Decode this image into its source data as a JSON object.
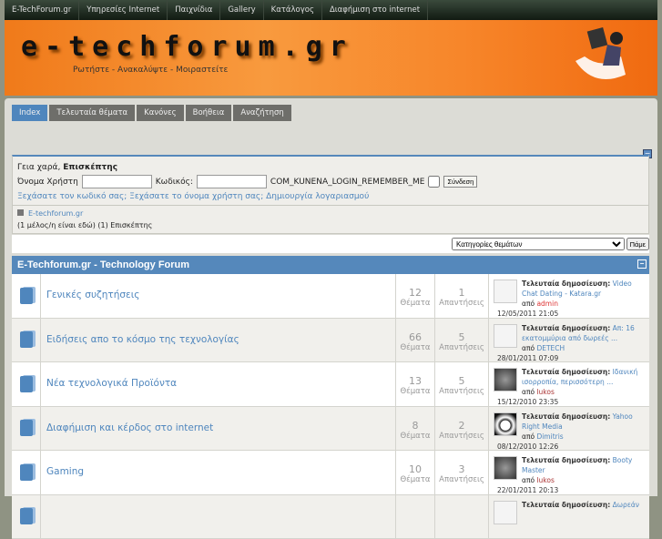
{
  "topnav": [
    "E-TechForum.gr",
    "Υπηρεσίες Internet",
    "Παιχνίδια",
    "Gallery",
    "Κατάλογος",
    "Διαφήμιση στο internet"
  ],
  "banner": {
    "logo": "e-techforum.gr",
    "slogan": "Ρωτήστε - Ανακαλύψτε - Μοιραστείτε"
  },
  "tabs": [
    "Index",
    "Τελευταία θέματα",
    "Κανόνες",
    "Βοήθεια",
    "Αναζήτηση"
  ],
  "login": {
    "greeting": "Γεια χαρά,",
    "guest": "Επισκέπτης",
    "username_label": "Όνομα Χρήστη",
    "password_label": "Κωδικός:",
    "remember_label": "COM_KUNENA_LOGIN_REMEMBER_ME",
    "submit": "Σύνδεση",
    "forgot_password": "Ξεχάσατε τον κωδικό σας;",
    "forgot_username": "Ξεχάσατε το όνομα χρήστη σας;",
    "register": "Δημιουργία λογαριασμού"
  },
  "who": {
    "site": "E-techforum.gr",
    "online": "(1 μέλος/η είναι εδώ) (1) Επισκέπτης"
  },
  "jump": {
    "selected": "Κατηγορίες θεμάτων",
    "go": "Πάμε"
  },
  "category": {
    "title": "E-Techforum.gr - Technology Forum",
    "collapse": "−"
  },
  "labels": {
    "topics": "Θέματα",
    "replies": "Απαντήσεις",
    "last_post": "Τελευταία δημοσίευση:",
    "by": "από"
  },
  "forums": [
    {
      "name": "Γενικές συζητήσεις",
      "topics": "12",
      "replies": "1",
      "last": "Video Chat Dating - Katara.gr",
      "user": "admin",
      "ucls": "u-admin",
      "date": "12/05/2011 21:05",
      "av": ""
    },
    {
      "name": "Ειδήσεις απο το κόσμο της τεχνολογίας",
      "topics": "66",
      "replies": "5",
      "last": "Απ: 16 εκατομμύρια από δωρεές ...",
      "user": "DETECH",
      "ucls": "u-blue",
      "date": "28/01/2011 07:09",
      "av": ""
    },
    {
      "name": "Νέα τεχνολογικά Προϊόντα",
      "topics": "13",
      "replies": "5",
      "last": "Ιδανική ισορροπία, περισσότερη ...",
      "user": "lukos",
      "ucls": "u-lukos",
      "date": "15/12/2010 23:35",
      "av": "apple"
    },
    {
      "name": "Διαφήμιση και κέρδος στο internet",
      "topics": "8",
      "replies": "2",
      "last": "Yahoo Right Media",
      "user": "Dimitris",
      "ucls": "u-blue",
      "date": "08/12/2010 12:26",
      "av": "ball"
    },
    {
      "name": "Gaming",
      "topics": "10",
      "replies": "3",
      "last": "Booty Master",
      "user": "lukos",
      "ucls": "u-lukos",
      "date": "22/01/2011 20:13",
      "av": "apple"
    },
    {
      "name": "",
      "topics": "",
      "replies": "",
      "last": "Δωρεάν",
      "user": "",
      "ucls": "",
      "date": "",
      "av": ""
    }
  ]
}
